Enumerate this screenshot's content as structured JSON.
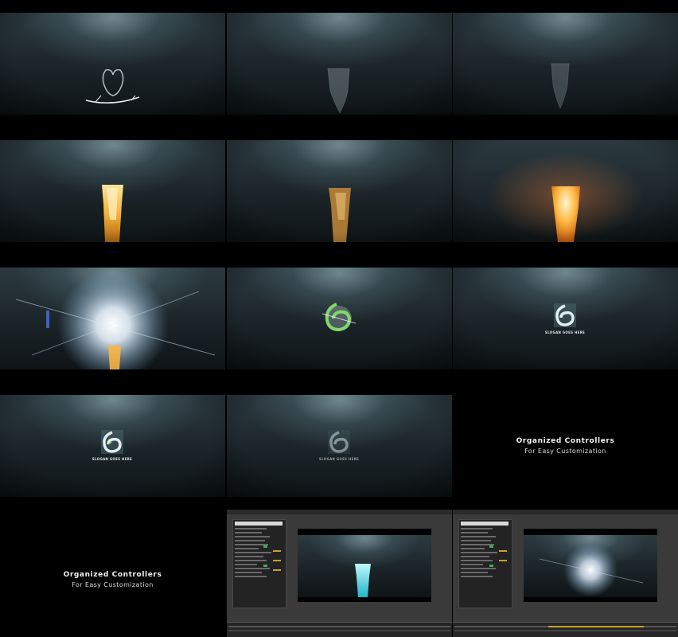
{
  "slides": {
    "title_card_a": {
      "title": "Organized Controllers",
      "subtitle": "For Easy Customization"
    },
    "title_card_b": {
      "title": "Organized Controllers",
      "subtitle": "For Easy Customization"
    },
    "slogan_1": "SLOGAN GOES HERE",
    "slogan_2": "SLOGAN GOES HERE",
    "slogan_3": "SLOGAN GOES HERE"
  },
  "colors": {
    "background": "#000000",
    "fire": "#f4b43a",
    "logo_green": "#7fd86a",
    "cyan_glow": "#3fe0e8",
    "ae_accent": "#c9a128"
  },
  "icons": [
    "logo-icon",
    "splash-icon",
    "fire-icon",
    "flare-icon"
  ]
}
